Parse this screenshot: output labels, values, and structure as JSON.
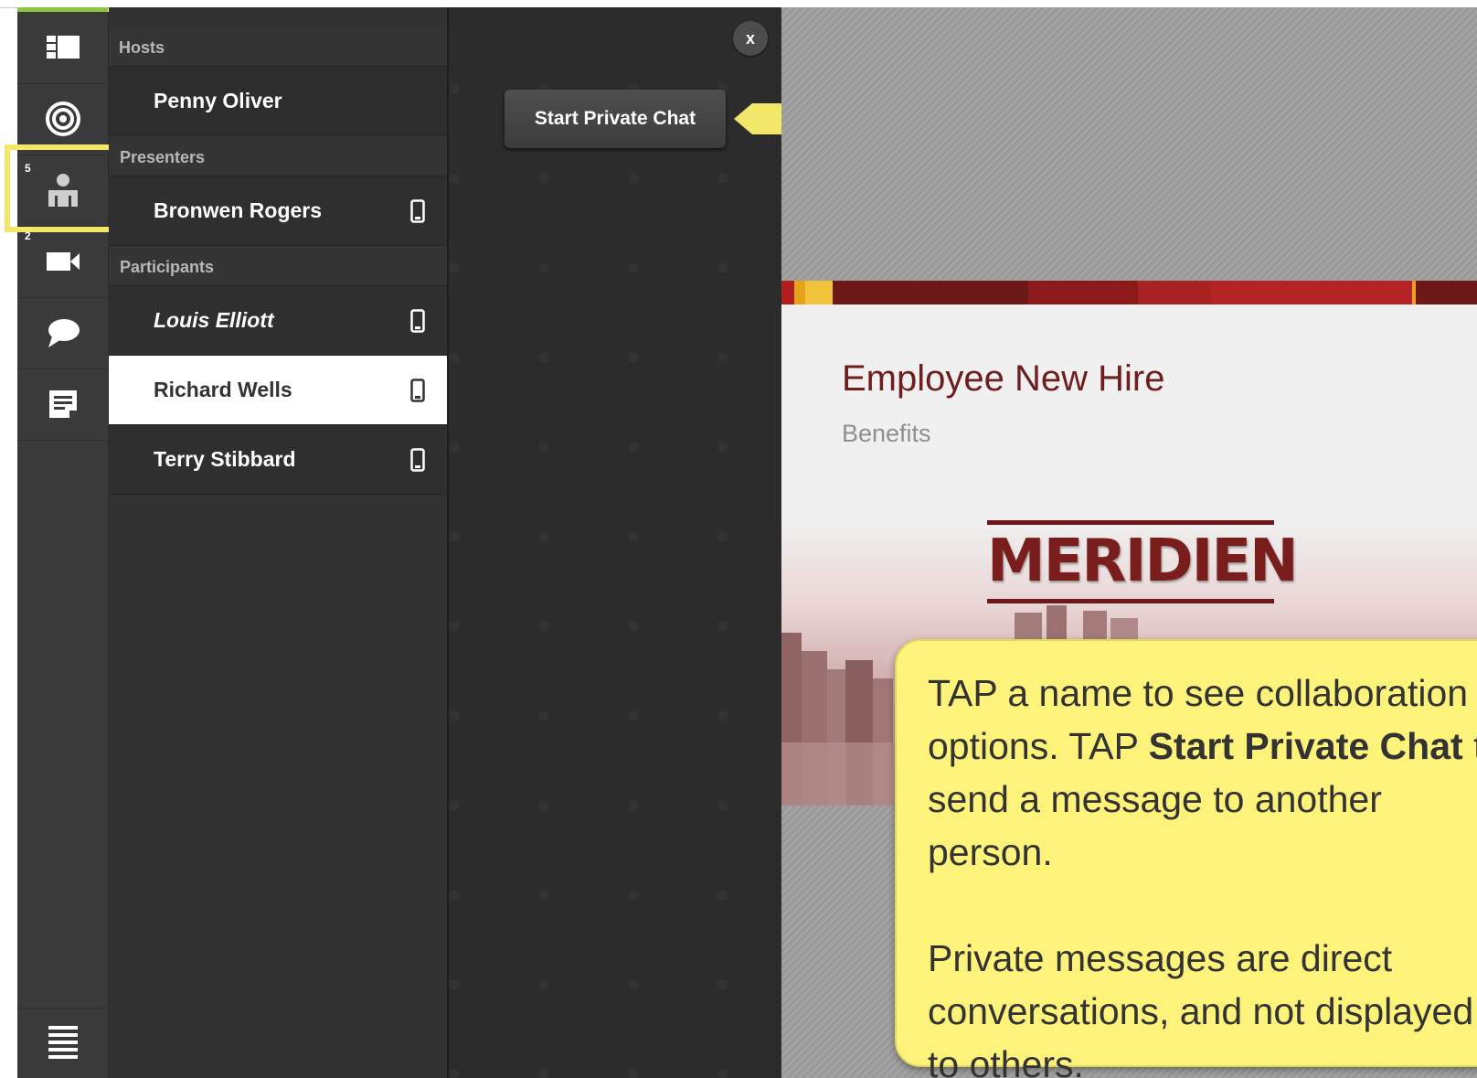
{
  "rail": {
    "attendees_badge": "5",
    "video_badge": "2"
  },
  "attendees": {
    "sections": {
      "hosts": "Hosts",
      "presenters": "Presenters",
      "participants": "Participants"
    },
    "hosts": [
      "Penny Oliver"
    ],
    "presenters": [
      "Bronwen Rogers"
    ],
    "participants": [
      "Louis Elliott",
      "Richard Wells",
      "Terry Stibbard"
    ]
  },
  "menu": {
    "close_label": "x",
    "start_private_chat": "Start Private Chat"
  },
  "slide": {
    "title": "Employee New Hire",
    "subtitle": "Benefits",
    "logo": "MERIDIEN"
  },
  "callout": {
    "line1_a": "TAP a name to see collaboration options. TAP ",
    "line1_bold": "Start Private Chat",
    "line1_b": " to send a message to another person.",
    "line2": "Private messages are direct conversations, and not displayed to others."
  },
  "colors": {
    "highlight": "#f3e76a",
    "callout": "#fdf27a",
    "accent": "#8ec63f",
    "brand": "#6d1818"
  },
  "icons": {
    "rail": [
      "layout-icon",
      "target-icon",
      "person-icon",
      "video-camera-icon",
      "chat-bubble-icon",
      "notes-icon",
      "menu-icon"
    ],
    "device": "mobile-device-icon"
  }
}
